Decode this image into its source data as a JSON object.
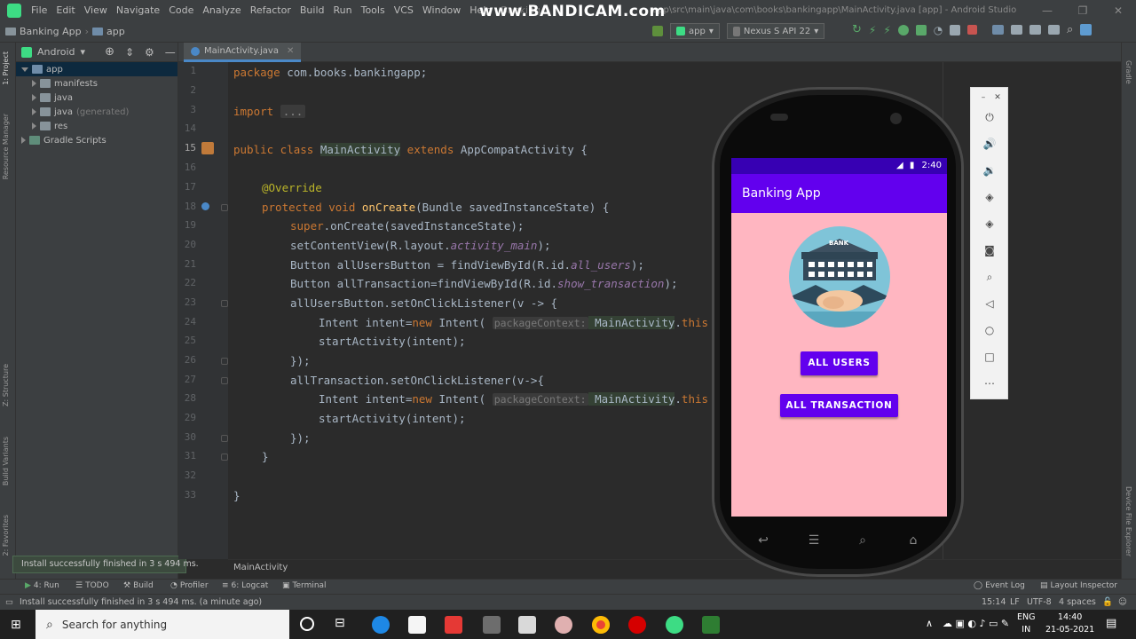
{
  "menubar": {
    "items": [
      "File",
      "Edit",
      "View",
      "Navigate",
      "Code",
      "Analyze",
      "Refactor",
      "Build",
      "Run",
      "Tools",
      "VCS",
      "Window",
      "Help"
    ],
    "title_prefix": "Banking",
    "title": "app\\src\\main\\java\\com\\books\\bankingapp\\MainActivity.java [app] - Android Studio",
    "watermark": "www.BANDICAM.com"
  },
  "toolbar": {
    "project": "Banking App",
    "module": "app",
    "run_config": "app",
    "device": "Nexus S API 22"
  },
  "project_panel": {
    "view_mode": "Android",
    "tree": [
      {
        "label": "app",
        "extra": "",
        "selected": true
      },
      {
        "label": "manifests",
        "extra": ""
      },
      {
        "label": "java",
        "extra": ""
      },
      {
        "label": "java",
        "extra": "(generated)"
      },
      {
        "label": "res",
        "extra": ""
      },
      {
        "label": "Gradle Scripts",
        "extra": ""
      }
    ]
  },
  "left_tool_tabs": [
    "1: Project",
    "Resource Manager",
    "Z: Structure",
    "Build Variants",
    "2: Favorites"
  ],
  "right_tool_tabs": [
    "Gradle",
    "Device File Explorer"
  ],
  "editor": {
    "tab": "MainActivity.java",
    "breadcrumb": "MainActivity",
    "line_numbers": [
      "1",
      "2",
      "3",
      "14",
      "15",
      "16",
      "17",
      "18",
      "19",
      "20",
      "21",
      "22",
      "23",
      "24",
      "25",
      "26",
      "27",
      "28",
      "29",
      "30",
      "31",
      "32",
      "33"
    ],
    "code": {
      "l1_kw": "package",
      "l1_rest": " com.books.bankingapp;",
      "l3_kw": "import",
      "l3_fold": "...",
      "l15_kw1": "public class ",
      "l15_cls": "MainActivity",
      "l15_kw2": " extends ",
      "l15_rest": "AppCompatActivity {",
      "l17": "@Override",
      "l18_kw": "protected void ",
      "l18_fn": "onCreate",
      "l18_rest": "(Bundle savedInstanceState) {",
      "l19_kw": "super",
      "l19_rest": ".onCreate(savedInstanceState);",
      "l20_a": "setContentView(R.layout.",
      "l20_it": "activity_main",
      "l20_b": ");",
      "l21_a": "Button allUsersButton = findViewById(R.id.",
      "l21_it": "all_users",
      "l21_b": ");",
      "l22_a": "Button allTransaction=findViewById(R.id.",
      "l22_it": "show_transaction",
      "l22_b": ");",
      "l23": "allUsersButton.setOnClickListener(v -> {",
      "l24_a": "Intent intent=",
      "l24_kw": "new ",
      "l24_b": "Intent( ",
      "l24_hint": "packageContext:",
      "l24_cls": " MainActivity",
      "l24_c": ".",
      "l24_kw2": "this",
      "l25": "startActivity(intent);",
      "l26": "});",
      "l27": "allTransaction.setOnClickListener(v->{",
      "l28_a": "Intent intent=",
      "l28_kw": "new ",
      "l28_b": "Intent( ",
      "l28_hint": "packageContext:",
      "l28_cls": " MainActivity",
      "l28_c": ".",
      "l28_kw2": "this",
      "l29": "startActivity(intent);",
      "l30": "});",
      "l31": "}",
      "l33": "}"
    }
  },
  "toast": "Install successfully finished in 3 s 494 ms.",
  "bottom_tabs": [
    "4: Run",
    "TODO",
    "Build",
    "Profiler",
    "6: Logcat",
    "Terminal",
    "Event Log",
    "Layout Inspector"
  ],
  "statusbar": {
    "message": "Install successfully finished in 3 s 494 ms. (a minute ago)",
    "position": "15:14",
    "line_sep": "LF",
    "encoding": "UTF-8",
    "indent": "4 spaces"
  },
  "emulator": {
    "time": "2:40",
    "app_title": "Banking App",
    "logo_text": "BANK",
    "button_users": "ALL USERS",
    "button_transaction": "ALL TRANSACTION",
    "side_controls": [
      "close",
      "power",
      "volume-up",
      "volume-down",
      "rotate-left",
      "rotate-right",
      "screenshot",
      "zoom",
      "back",
      "home",
      "overview",
      "more"
    ]
  },
  "taskbar": {
    "search_placeholder": "Search for anything",
    "lang1": "ENG",
    "lang2": "IN",
    "time": "14:40",
    "date": "21-05-2021"
  }
}
